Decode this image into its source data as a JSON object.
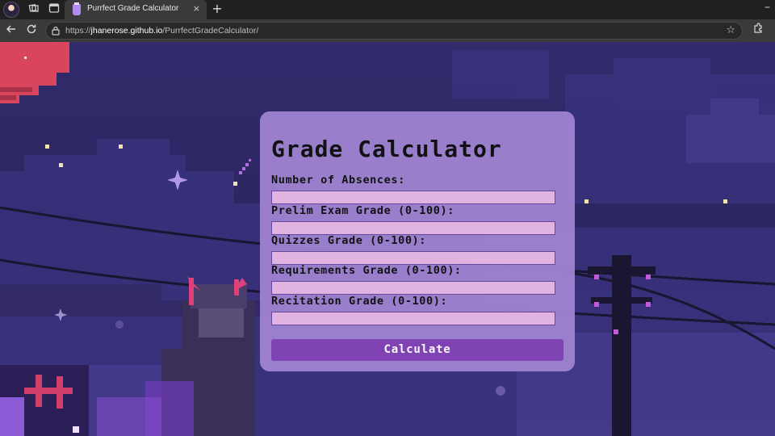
{
  "browser": {
    "tab_title": "Purrfect Grade Calculator",
    "tab_close": "×",
    "new_tab": "+",
    "minimize": "–",
    "url_prefix": "https://",
    "url_host": "jhanerose.github.io",
    "url_path": "/PurrfectGradeCalculator/",
    "icons": [
      "profile-avatar",
      "workspaces-icon",
      "tab-actions-icon",
      "back-icon",
      "reload-icon",
      "lock-icon",
      "favorite-star-icon",
      "extensions-icon"
    ]
  },
  "calculator": {
    "title": "Grade Calculator",
    "fields": [
      {
        "label": "Number of Absences:",
        "value": ""
      },
      {
        "label": "Prelim Exam Grade (0-100):",
        "value": ""
      },
      {
        "label": "Quizzes Grade (0-100):",
        "value": ""
      },
      {
        "label": "Requirements Grade (0-100):",
        "value": ""
      },
      {
        "label": "Recitation Grade (0-100):",
        "value": ""
      }
    ],
    "button_label": "Calculate"
  },
  "colors": {
    "card": "#9d82cf",
    "input": "#e6b8e6",
    "button": "#8244b6",
    "sky": "#2c2762",
    "planet": "#d9455d"
  }
}
